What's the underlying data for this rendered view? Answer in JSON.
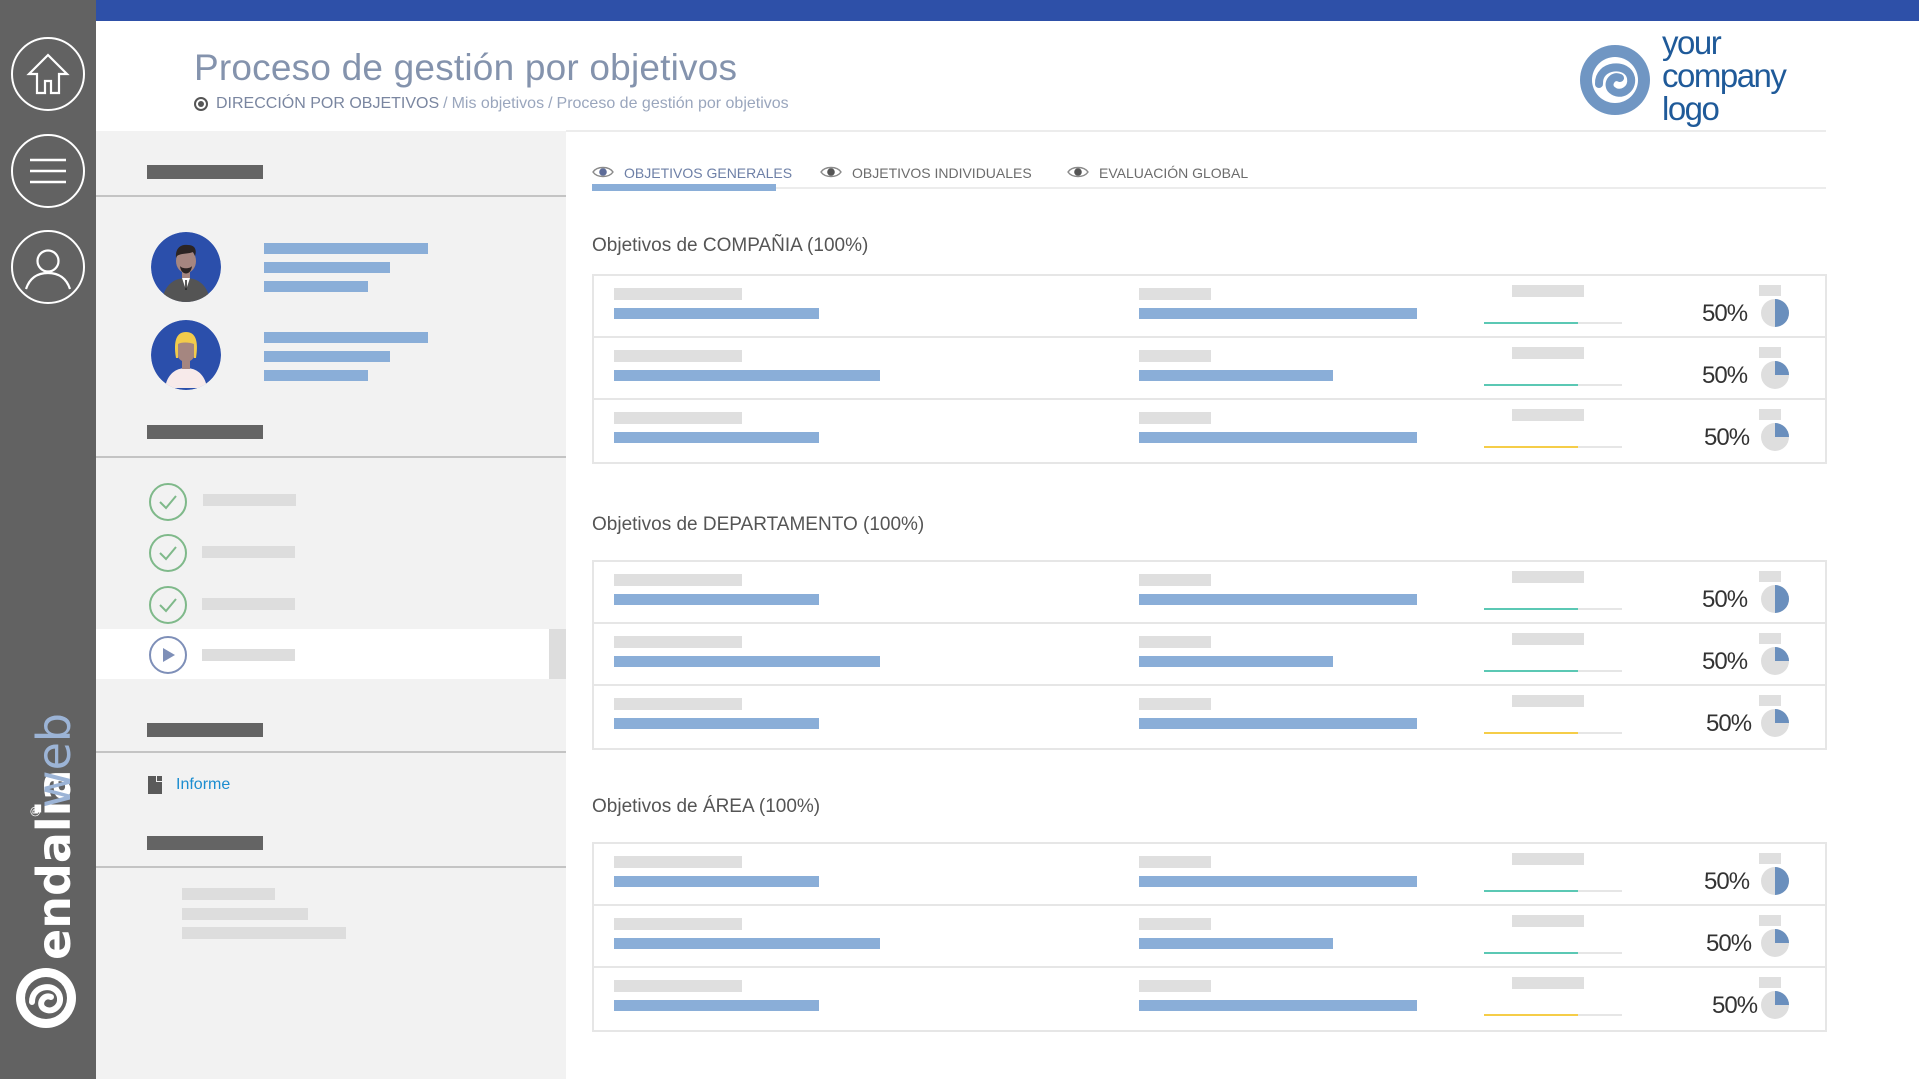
{
  "app": {
    "brand_name": "endalia",
    "brand_suffix": "web",
    "brand_registered": "®",
    "company_logo_lines": [
      "your",
      "company",
      "logo"
    ]
  },
  "rail": {
    "items": [
      {
        "icon": "home-icon",
        "label": "Inicio"
      },
      {
        "icon": "menu-icon",
        "label": "Menú"
      },
      {
        "icon": "user-icon",
        "label": "Perfil"
      }
    ]
  },
  "header": {
    "title": "Proceso de gestión por objetivos",
    "breadcrumb": {
      "root": "DIRECCIÓN POR OBJETIVOS",
      "separator": "/",
      "items": [
        "Mis objetivos",
        "Proceso de gestión por objetivos"
      ]
    }
  },
  "sidebar": {
    "people": [
      {
        "avatar": "avatar-man",
        "name": "",
        "role": "",
        "detail": ""
      },
      {
        "avatar": "avatar-woman",
        "name": "",
        "role": "",
        "detail": ""
      }
    ],
    "steps": [
      {
        "status": "completed",
        "icon": "check-circle-icon"
      },
      {
        "status": "completed",
        "icon": "check-circle-icon"
      },
      {
        "status": "completed",
        "icon": "check-circle-icon"
      },
      {
        "status": "current",
        "icon": "play-circle-icon"
      }
    ],
    "report_link": "Informe"
  },
  "tabs": [
    {
      "label": "OBJETIVOS GENERALES",
      "active": true
    },
    {
      "label": "OBJETIVOS INDIVIDUALES",
      "active": false
    },
    {
      "label": "EVALUACIÓN GLOBAL",
      "active": false
    }
  ],
  "sections": [
    {
      "title": "Objetivos de COMPAÑIA (100%)",
      "rows": [
        {
          "percent_label": "50%",
          "pie_fraction": 0.5,
          "progress_fraction": 0.68,
          "progress_color": "#5bc8b4"
        },
        {
          "percent_label": "50%",
          "pie_fraction": 0.25,
          "progress_fraction": 0.68,
          "progress_color": "#5bc8b4"
        },
        {
          "percent_label": "50%",
          "pie_fraction": 0.25,
          "progress_fraction": 0.68,
          "progress_color": "#f5cd48"
        }
      ]
    },
    {
      "title": "Objetivos de DEPARTAMENTO (100%)",
      "rows": [
        {
          "percent_label": "50%",
          "pie_fraction": 0.5,
          "progress_fraction": 0.68,
          "progress_color": "#5bc8b4"
        },
        {
          "percent_label": "50%",
          "pie_fraction": 0.25,
          "progress_fraction": 0.68,
          "progress_color": "#5bc8b4"
        },
        {
          "percent_label": "50%",
          "pie_fraction": 0.25,
          "progress_fraction": 0.68,
          "progress_color": "#f5cd48"
        }
      ]
    },
    {
      "title": "Objetivos de ÁREA (100%)",
      "rows": [
        {
          "percent_label": "50%",
          "pie_fraction": 0.5,
          "progress_fraction": 0.68,
          "progress_color": "#5bc8b4"
        },
        {
          "percent_label": "50%",
          "pie_fraction": 0.25,
          "progress_fraction": 0.68,
          "progress_color": "#5bc8b4"
        },
        {
          "percent_label": "50%",
          "pie_fraction": 0.25,
          "progress_fraction": 0.68,
          "progress_color": "#f5cd48"
        }
      ]
    }
  ],
  "colors": {
    "top_bar": "#2e50a8",
    "rail": "#626262",
    "placeholder_blue": "#8aaed8",
    "pie_fill": "#6a8fbd",
    "pie_track": "#dedede",
    "link": "#1c8dd0",
    "step_done": "#7fb98a",
    "step_current": "#7e8fb8"
  }
}
